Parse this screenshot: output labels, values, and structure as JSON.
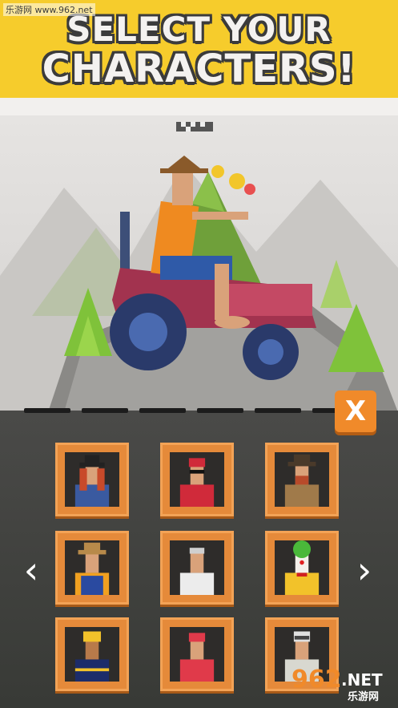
{
  "header": {
    "line1": "SELECT YOUR",
    "line2": "CHARACTERS!"
  },
  "watermark": {
    "top_text": "乐游网 www.962.net",
    "logo_text": "962",
    "logo_suffix": ".NET",
    "logo_sub": "乐游网"
  },
  "close_button": {
    "label": "X"
  },
  "nav": {
    "prev": "‹",
    "next": "›"
  },
  "characters": [
    {
      "id": "cowboy-girl"
    },
    {
      "id": "cyclist-sunglasses"
    },
    {
      "id": "bearded-cowboy"
    },
    {
      "id": "farmer-overalls"
    },
    {
      "id": "old-man-white-shirt"
    },
    {
      "id": "clown"
    },
    {
      "id": "firefighter"
    },
    {
      "id": "red-cap-rider"
    },
    {
      "id": "goggles-pilot"
    }
  ],
  "colors": {
    "banner": "#f6cc2c",
    "card": "#e58a3a",
    "close_button": "#f08a2a"
  }
}
